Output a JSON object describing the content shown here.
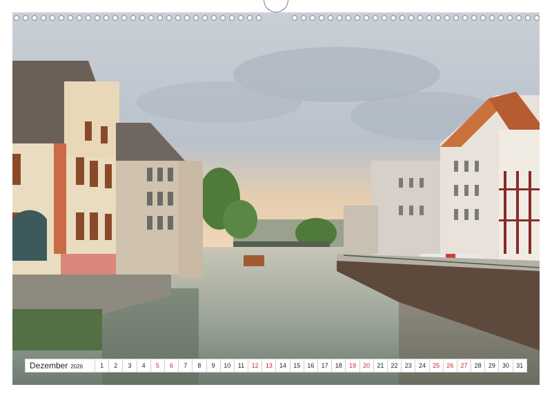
{
  "calendar": {
    "month": "Dezember",
    "year": "2026",
    "days": [
      {
        "n": "1",
        "we": false
      },
      {
        "n": "2",
        "we": false
      },
      {
        "n": "3",
        "we": false
      },
      {
        "n": "4",
        "we": false
      },
      {
        "n": "5",
        "we": true
      },
      {
        "n": "6",
        "we": true
      },
      {
        "n": "7",
        "we": false
      },
      {
        "n": "8",
        "we": false
      },
      {
        "n": "9",
        "we": false
      },
      {
        "n": "10",
        "we": false
      },
      {
        "n": "11",
        "we": false
      },
      {
        "n": "12",
        "we": true
      },
      {
        "n": "13",
        "we": true
      },
      {
        "n": "14",
        "we": false
      },
      {
        "n": "15",
        "we": false
      },
      {
        "n": "16",
        "we": false
      },
      {
        "n": "17",
        "we": false
      },
      {
        "n": "18",
        "we": false
      },
      {
        "n": "19",
        "we": true
      },
      {
        "n": "20",
        "we": true
      },
      {
        "n": "21",
        "we": false
      },
      {
        "n": "22",
        "we": false
      },
      {
        "n": "23",
        "we": false
      },
      {
        "n": "24",
        "we": false
      },
      {
        "n": "25",
        "we": true
      },
      {
        "n": "26",
        "we": true
      },
      {
        "n": "27",
        "we": true
      },
      {
        "n": "28",
        "we": false
      },
      {
        "n": "29",
        "we": false
      },
      {
        "n": "30",
        "we": false
      },
      {
        "n": "31",
        "we": false
      }
    ],
    "weekend_color": "#c62828"
  },
  "photo": {
    "subject": "canal-with-half-timbered-houses"
  }
}
